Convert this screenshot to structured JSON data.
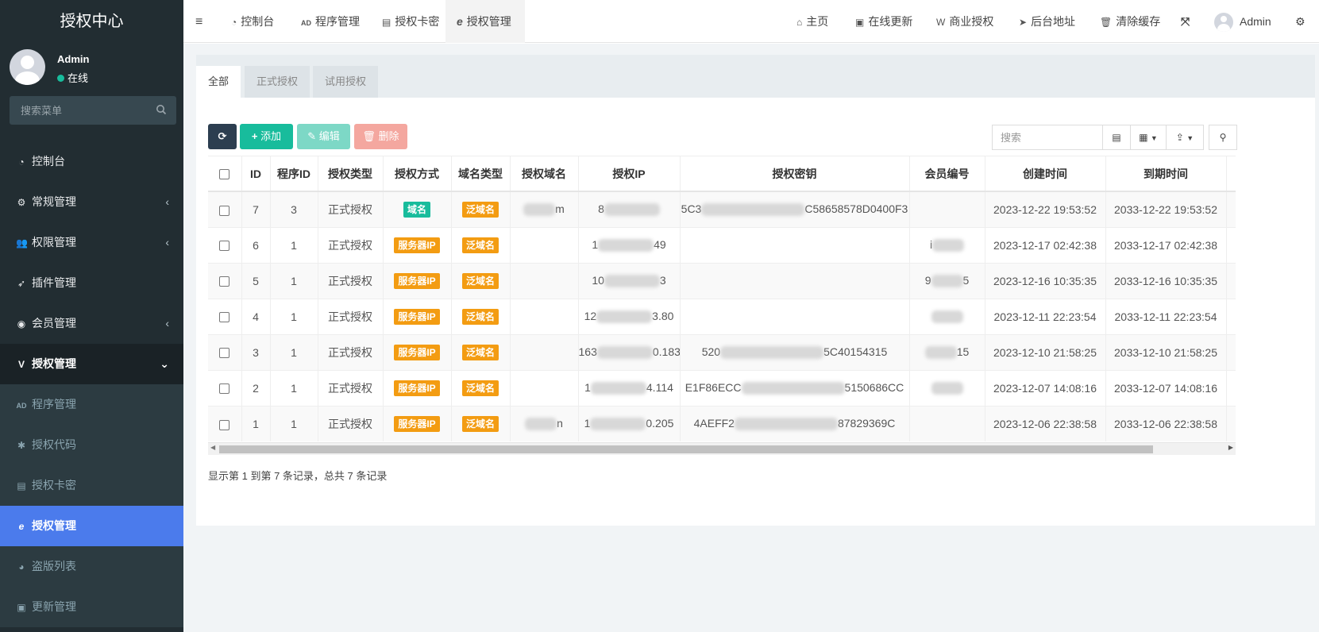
{
  "sidebar": {
    "brand": "授权中心",
    "user": {
      "name": "Admin",
      "status": "在线"
    },
    "search_placeholder": "搜索菜单",
    "menu": [
      {
        "label": "控制台",
        "icon": "dashboard-icon"
      },
      {
        "label": "常规管理",
        "icon": "cogs-icon",
        "expandable": true
      },
      {
        "label": "权限管理",
        "icon": "group-icon",
        "expandable": true
      },
      {
        "label": "插件管理",
        "icon": "rocket-icon"
      },
      {
        "label": "会员管理",
        "icon": "user-circle-icon",
        "expandable": true
      },
      {
        "label": "授权管理",
        "icon": "vimeo-icon",
        "expanded": true
      }
    ],
    "submenu": [
      {
        "label": "程序管理",
        "icon": "adn-icon"
      },
      {
        "label": "授权代码",
        "icon": "bug-icon"
      },
      {
        "label": "授权卡密",
        "icon": "id-card-icon"
      },
      {
        "label": "授权管理",
        "icon": "ie-icon",
        "active": true
      },
      {
        "label": "盗版列表",
        "icon": "pie-chart-icon"
      },
      {
        "label": "更新管理",
        "icon": "vimeo-square-icon"
      }
    ]
  },
  "topnav": {
    "left": [
      {
        "label": "控制台",
        "icon": "dashboard-icon"
      },
      {
        "label": "程序管理",
        "icon": "adn-icon"
      },
      {
        "label": "授权卡密",
        "icon": "id-card-icon"
      },
      {
        "label": "授权管理",
        "icon": "ie-icon",
        "active": true
      }
    ],
    "right": [
      {
        "label": "主页",
        "icon": "home-icon"
      },
      {
        "label": "在线更新",
        "icon": "vimeo-square-icon"
      },
      {
        "label": "商业授权",
        "icon": "wpforms-icon"
      },
      {
        "label": "后台地址",
        "icon": "send-icon"
      },
      {
        "label": "清除缓存",
        "icon": "trash-icon"
      }
    ],
    "admin": "Admin"
  },
  "tabs": [
    "全部",
    "正式授权",
    "试用授权"
  ],
  "toolbar": {
    "add": "添加",
    "edit": "编辑",
    "delete": "删除",
    "search_placeholder": "搜索"
  },
  "table": {
    "columns": [
      "ID",
      "程序ID",
      "授权类型",
      "授权方式",
      "域名类型",
      "授权域名",
      "授权IP",
      "授权密钥",
      "会员编号",
      "创建时间",
      "到期时间"
    ],
    "rows": [
      {
        "id": "7",
        "pid": "3",
        "type": "正式授权",
        "method": "域名",
        "method_color": "#18bc9c",
        "dtype": "泛域名",
        "domain": "m",
        "ip": "8",
        "key_start": "5C3",
        "key_end": "C58658578D0400F3",
        "member": "",
        "created": "2023-12-22 19:53:52",
        "expires": "2033-12-22 19:53:52"
      },
      {
        "id": "6",
        "pid": "1",
        "type": "正式授权",
        "method": "服务器IP",
        "method_color": "#f39c12",
        "dtype": "泛域名",
        "domain": "",
        "ip": "1",
        "ip_end": "49",
        "key_start": "",
        "key_end": "",
        "member": "i",
        "created": "2023-12-17 02:42:38",
        "expires": "2033-12-17 02:42:38"
      },
      {
        "id": "5",
        "pid": "1",
        "type": "正式授权",
        "method": "服务器IP",
        "method_color": "#f39c12",
        "dtype": "泛域名",
        "domain": "",
        "ip": "10",
        "ip_end": "3",
        "key_start": "",
        "key_end": "",
        "member": "9",
        "member_end": "5",
        "created": "2023-12-16 10:35:35",
        "expires": "2033-12-16 10:35:35"
      },
      {
        "id": "4",
        "pid": "1",
        "type": "正式授权",
        "method": "服务器IP",
        "method_color": "#f39c12",
        "dtype": "泛域名",
        "domain": "",
        "ip": "12",
        "ip_end": "3.80",
        "key_start": "",
        "key_end": "",
        "member": "",
        "created": "2023-12-11 22:23:54",
        "expires": "2033-12-11 22:23:54"
      },
      {
        "id": "3",
        "pid": "1",
        "type": "正式授权",
        "method": "服务器IP",
        "method_color": "#f39c12",
        "dtype": "泛域名",
        "domain": "",
        "ip": "163",
        "ip_end": "0.183",
        "key_start": "520",
        "key_end": "5C40154315",
        "member": "",
        "member_end": "15",
        "created": "2023-12-10 21:58:25",
        "expires": "2033-12-10 21:58:25"
      },
      {
        "id": "2",
        "pid": "1",
        "type": "正式授权",
        "method": "服务器IP",
        "method_color": "#f39c12",
        "dtype": "泛域名",
        "domain": "",
        "ip": "1",
        "ip_end": "4.114",
        "key_start": "E1F86ECC",
        "key_end": "5150686CC",
        "member": "",
        "created": "2023-12-07 14:08:16",
        "expires": "2033-12-07 14:08:16"
      },
      {
        "id": "1",
        "pid": "1",
        "type": "正式授权",
        "method": "服务器IP",
        "method_color": "#f39c12",
        "dtype": "泛域名",
        "domain": "n",
        "ip": "1",
        "ip_end": "0.205",
        "key_start": "4AEFF2",
        "key_end": "87829369C",
        "member": "",
        "created": "2023-12-06 22:38:58",
        "expires": "2033-12-06 22:38:58"
      }
    ]
  },
  "pager_info": "显示第 1 到第 7 条记录，总共 7 条记录"
}
